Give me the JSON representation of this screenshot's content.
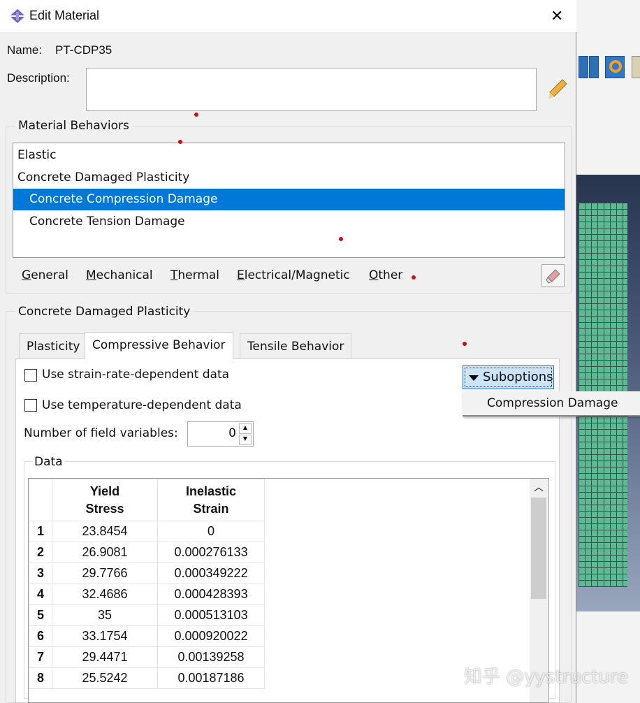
{
  "window": {
    "title": "Edit Material",
    "close": "✕"
  },
  "name_label": "Name:",
  "name_value": "PT-CDP35",
  "description_label": "Description:",
  "description_value": "",
  "behaviors": {
    "title": "Material Behaviors",
    "items": [
      "Elastic",
      "Concrete Damaged Plasticity",
      "Concrete Compression Damage",
      "Concrete Tension Damage"
    ],
    "selected": "Concrete Compression Damage"
  },
  "menu": [
    {
      "u": "G",
      "rest": "eneral"
    },
    {
      "u": "M",
      "rest": "echanical"
    },
    {
      "u": "T",
      "rest": "hermal"
    },
    {
      "u": "E",
      "rest": "lectrical/Magnetic"
    },
    {
      "u": "O",
      "rest": "ther"
    }
  ],
  "section": {
    "title": "Concrete Damaged Plasticity",
    "tabs": [
      "Plasticity",
      "Compressive Behavior",
      "Tensile Behavior"
    ],
    "active_tab": "Compressive Behavior",
    "strain_rate_label": "Use strain-rate-dependent data",
    "strain_rate_checked": false,
    "temperature_label": "Use temperature-dependent data",
    "temperature_checked": false,
    "field_vars_label": "Number of field variables:",
    "field_vars_value": "0",
    "suboptions_label": "Suboptions",
    "suboptions_menu": [
      "Compression Damage"
    ],
    "data_title": "Data",
    "columns": [
      "Yield Stress",
      "Inelastic Strain"
    ],
    "rows": [
      [
        "1",
        "23.8454",
        "0"
      ],
      [
        "2",
        "26.9081",
        "0.000276133"
      ],
      [
        "3",
        "29.7766",
        "0.000349222"
      ],
      [
        "4",
        "32.4686",
        "0.000428393"
      ],
      [
        "5",
        "35",
        "0.000513103"
      ],
      [
        "6",
        "33.1754",
        "0.000920022"
      ],
      [
        "7",
        "29.4471",
        "0.00139258"
      ],
      [
        "8",
        "25.5242",
        "0.00187186"
      ]
    ]
  },
  "colors": {
    "selection": "#0078d7",
    "viewport": "#27354f",
    "mesh": "#5fb894"
  },
  "watermark": "知乎 @yystructure"
}
